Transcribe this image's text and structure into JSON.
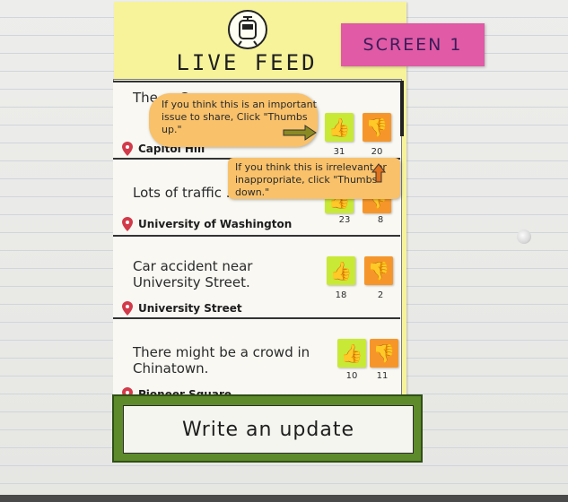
{
  "header": {
    "title": "LIVE FEED",
    "screen_label": "SCREEN 1"
  },
  "tooltips": {
    "upvote_help": "If you think this is an important issue to share, Click \"Thumbs up.\"",
    "downvote_help": "If you think this is irrelevant or inappropriate, click \"Thumbs down.\""
  },
  "feed": [
    {
      "text": "The ... Co...",
      "location": "Capitol Hill",
      "up": "31",
      "down": "20"
    },
    {
      "text": "Lots of traffic ... station.",
      "location": "University of Washington",
      "up": "23",
      "down": "8"
    },
    {
      "text": "Car accident near University Street.",
      "location": "University Street",
      "up": "18",
      "down": "2"
    },
    {
      "text": "There might be a crowd in Chinatown.",
      "location": "Pioneer Square",
      "up": "10",
      "down": "11"
    }
  ],
  "actions": {
    "write_update": "Write an update"
  },
  "icons": {
    "app": "train-icon",
    "location": "map-pin-icon",
    "upvote": "thumbs-up-icon",
    "downvote": "thumbs-down-icon"
  },
  "colors": {
    "phone_bg": "#f7f39b",
    "screen_label": "#e05aa5",
    "thumbs_up": "#c8e936",
    "thumbs_down": "#f6962a",
    "tooltip": "#f8c16a",
    "button_frame": "#5d8a2a"
  }
}
